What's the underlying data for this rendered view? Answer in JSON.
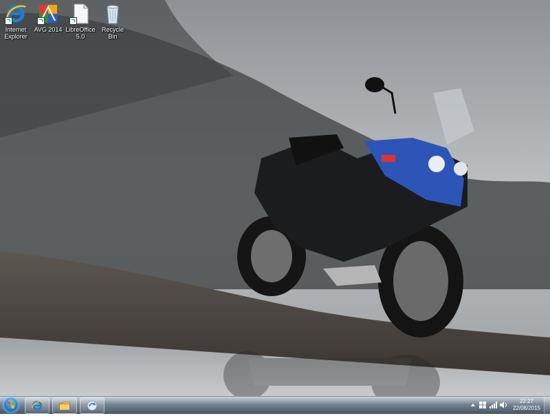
{
  "desktop_icons": [
    {
      "name": "internet-explorer",
      "label_line1": "Internet",
      "label_line2": "Explorer",
      "icon": "internet-explorer-icon"
    },
    {
      "name": "avg-2014",
      "label_line1": "AVG 2014",
      "label_line2": "",
      "icon": "avg-icon"
    },
    {
      "name": "libreoffice",
      "label_line1": "LibreOffice",
      "label_line2": "5.0",
      "icon": "libreoffice-icon"
    },
    {
      "name": "recycle-bin",
      "label_line1": "Recycle Bin",
      "label_line2": "",
      "icon": "recycle-bin-icon"
    }
  ],
  "wallpaper": {
    "subject": "motorcycle"
  },
  "taskbar": {
    "pinned": [
      {
        "name": "internet-explorer",
        "icon": "internet-explorer-icon"
      },
      {
        "name": "windows-explorer",
        "icon": "folder-icon"
      },
      {
        "name": "windows-update",
        "icon": "update-icon"
      }
    ]
  },
  "tray": {
    "icons": [
      "flag-icon",
      "network-icon",
      "volume-icon"
    ],
    "time": "22:27",
    "date": "22/08/2015"
  },
  "colors": {
    "accent_ie": "#1e7fd8",
    "start_orb": "#2e86d6"
  }
}
